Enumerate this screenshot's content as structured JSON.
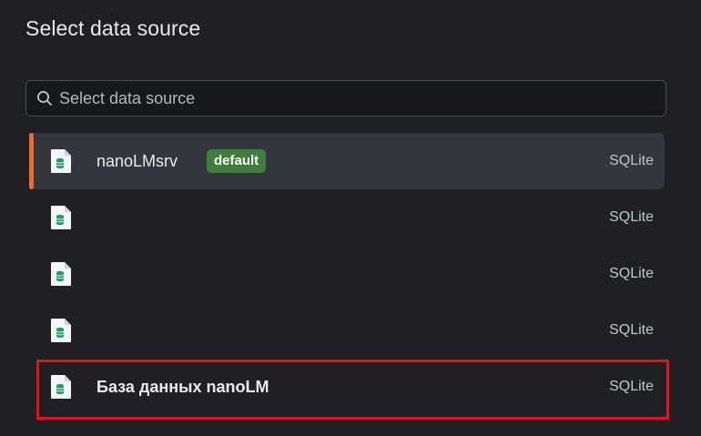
{
  "dialog": {
    "title": "Select data source",
    "search": {
      "placeholder": "Select data source",
      "value": "",
      "icon": "search-icon"
    },
    "items": [
      {
        "name": "nanoLMsrv",
        "badge": "default",
        "type": "SQLite",
        "icon": "sqlite-file-icon",
        "selected": true
      },
      {
        "name": "",
        "badge": "",
        "type": "SQLite",
        "icon": "sqlite-file-icon",
        "selected": false
      },
      {
        "name": "",
        "badge": "",
        "type": "SQLite",
        "icon": "sqlite-file-icon",
        "selected": false
      },
      {
        "name": "",
        "badge": "",
        "type": "SQLite",
        "icon": "sqlite-file-icon",
        "selected": false
      },
      {
        "name": "База данных nanoLM",
        "badge": "",
        "type": "SQLite",
        "icon": "sqlite-file-icon",
        "selected": false
      }
    ]
  },
  "colors": {
    "background": "#1e2024",
    "selected_row": "#33363c",
    "accent": "#f26a2e",
    "badge": "#3f7d3c",
    "db_icon": "#1f9d63",
    "highlight_border": "#e0141b"
  }
}
